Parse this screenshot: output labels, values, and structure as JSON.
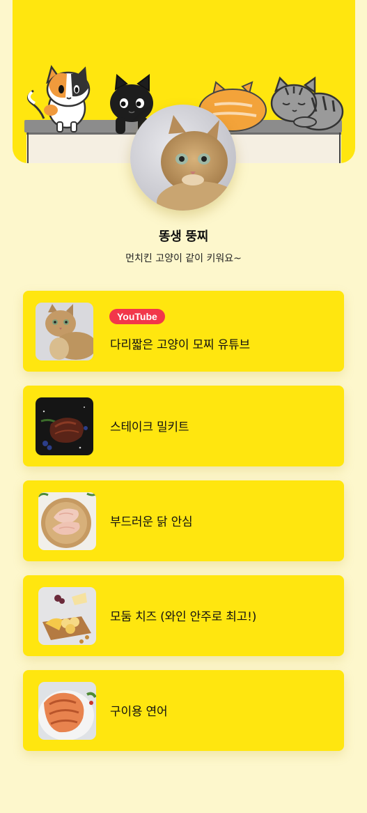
{
  "profile": {
    "name": "똥생 뚱찌",
    "bio": "먼치킨 고양이 같이 키워요~"
  },
  "links": [
    {
      "label": "다리짧은 고양이 모찌 유튜브",
      "badge": "YouTube",
      "thumb_icon": "cat-photo"
    },
    {
      "label": "스테이크 밀키트",
      "thumb_icon": "steak-photo"
    },
    {
      "label": "부드러운 닭 안심",
      "thumb_icon": "chicken-breast-photo"
    },
    {
      "label": "모둠 치즈 (와인 안주로 최고!)",
      "thumb_icon": "cheese-board-photo"
    },
    {
      "label": "구이용 연어",
      "thumb_icon": "salmon-steak-photo"
    }
  ],
  "colors": {
    "background": "#fdf7cc",
    "card": "#ffe60f",
    "badge": "#f2374a"
  }
}
